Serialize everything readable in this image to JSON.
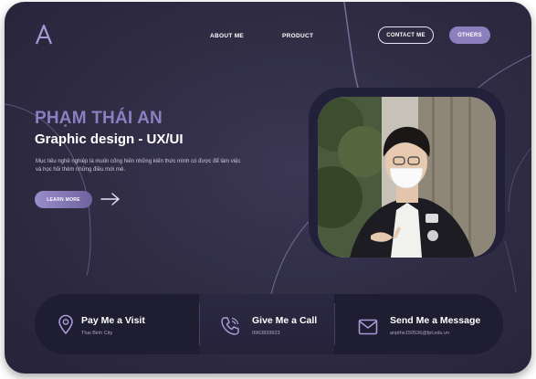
{
  "nav": {
    "logo_letter": "A",
    "about_label": "ABOUT ME",
    "product_label": "PRODUCT",
    "contact_label": "CONTACT ME",
    "others_label": "OTHERS"
  },
  "hero": {
    "name": "PHẠM THÁI AN",
    "role": "Graphic design - UX/UI",
    "description": "Mục tiêu nghề nghiệp là muốn cống hiến những kiến  thức mình có được để làm việc và học hỏi thêm những điều mới mẻ.",
    "cta_label": "LEARN MORE"
  },
  "contact": {
    "visit_title": "Pay Me a Visit",
    "visit_sub": "Thai Binh City",
    "call_title": "Give Me a Call",
    "call_sub": "0963839923",
    "message_title": "Send Me a Message",
    "message_sub": "anpthe150536@fpt.edu.vn"
  },
  "icons": {
    "visit": "map-pin-icon",
    "call": "phone-icon",
    "message": "mail-icon",
    "cta": "arrow-right-icon"
  },
  "colors": {
    "background": "#2e2b42",
    "accent": "#8b7fc1",
    "button": "#8c7fbd",
    "info_bar": "#1f1d31"
  }
}
